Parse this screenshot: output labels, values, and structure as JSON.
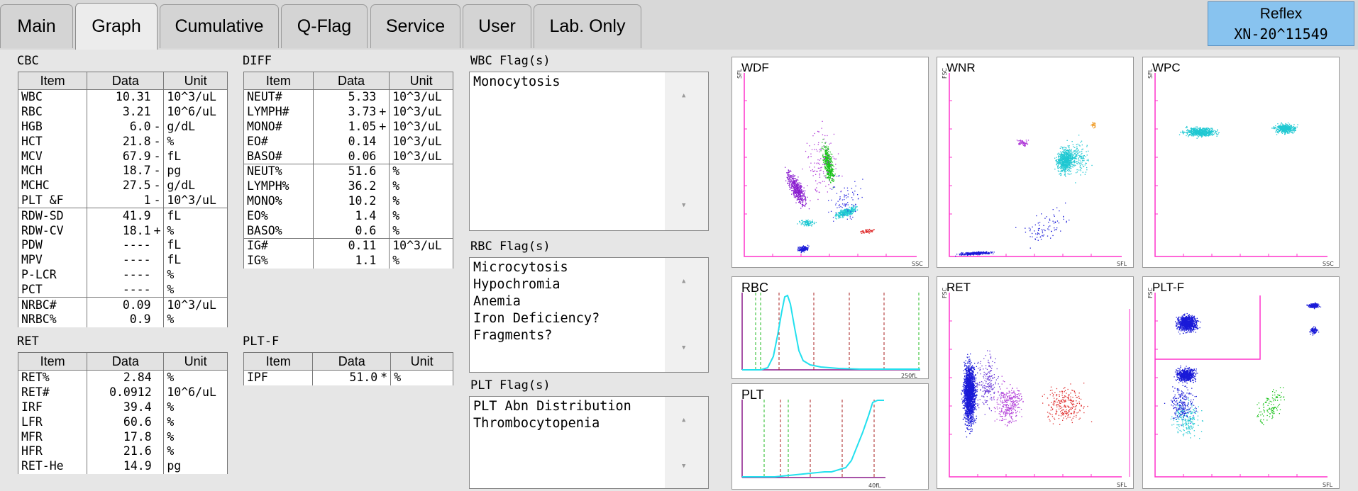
{
  "tabs": [
    "Main",
    "Graph",
    "Cumulative",
    "Q-Flag",
    "Service",
    "User",
    "Lab. Only"
  ],
  "active_tab": "Graph",
  "reflex": {
    "label": "Reflex",
    "sample_id": "XN-20^11549"
  },
  "cbc": {
    "title": "CBC",
    "headers": [
      "Item",
      "Data",
      "Unit"
    ],
    "rows": [
      {
        "item": "WBC",
        "data": "10.31",
        "flag": "",
        "unit": "10^3/uL"
      },
      {
        "item": "RBC",
        "data": "3.21",
        "flag": "",
        "unit": "10^6/uL"
      },
      {
        "item": "HGB",
        "data": "6.0",
        "flag": "-",
        "unit": "g/dL"
      },
      {
        "item": "HCT",
        "data": "21.8",
        "flag": "-",
        "unit": "%"
      },
      {
        "item": "MCV",
        "data": "67.9",
        "flag": "-",
        "unit": "fL"
      },
      {
        "item": "MCH",
        "data": "18.7",
        "flag": "-",
        "unit": "pg"
      },
      {
        "item": "MCHC",
        "data": "27.5",
        "flag": "-",
        "unit": "g/dL"
      },
      {
        "item": "PLT &F",
        "data": "1",
        "flag": "-",
        "unit": "10^3/uL"
      },
      {
        "item": "RDW-SD",
        "data": "41.9",
        "flag": "",
        "unit": "fL"
      },
      {
        "item": "RDW-CV",
        "data": "18.1",
        "flag": "+",
        "unit": "%"
      },
      {
        "item": "PDW",
        "data": "----",
        "flag": "",
        "unit": "fL"
      },
      {
        "item": "MPV",
        "data": "----",
        "flag": "",
        "unit": "fL"
      },
      {
        "item": "P-LCR",
        "data": "----",
        "flag": "",
        "unit": "%"
      },
      {
        "item": "PCT",
        "data": "----",
        "flag": "",
        "unit": "%"
      },
      {
        "item": "NRBC#",
        "data": "0.09",
        "flag": "",
        "unit": "10^3/uL"
      },
      {
        "item": "NRBC%",
        "data": "0.9",
        "flag": "",
        "unit": "%"
      }
    ]
  },
  "diff": {
    "title": "DIFF",
    "headers": [
      "Item",
      "Data",
      "Unit"
    ],
    "rows": [
      {
        "item": "NEUT#",
        "data": "5.33",
        "flag": "",
        "unit": "10^3/uL"
      },
      {
        "item": "LYMPH#",
        "data": "3.73",
        "flag": "+",
        "unit": "10^3/uL"
      },
      {
        "item": "MONO#",
        "data": "1.05",
        "flag": "+",
        "unit": "10^3/uL"
      },
      {
        "item": "EO#",
        "data": "0.14",
        "flag": "",
        "unit": "10^3/uL"
      },
      {
        "item": "BASO#",
        "data": "0.06",
        "flag": "",
        "unit": "10^3/uL"
      },
      {
        "item": "NEUT%",
        "data": "51.6",
        "flag": "",
        "unit": "%"
      },
      {
        "item": "LYMPH%",
        "data": "36.2",
        "flag": "",
        "unit": "%"
      },
      {
        "item": "MONO%",
        "data": "10.2",
        "flag": "",
        "unit": "%"
      },
      {
        "item": "EO%",
        "data": "1.4",
        "flag": "",
        "unit": "%"
      },
      {
        "item": "BASO%",
        "data": "0.6",
        "flag": "",
        "unit": "%"
      },
      {
        "item": "IG#",
        "data": "0.11",
        "flag": "",
        "unit": "10^3/uL"
      },
      {
        "item": "IG%",
        "data": "1.1",
        "flag": "",
        "unit": "%"
      }
    ]
  },
  "ret": {
    "title": "RET",
    "headers": [
      "Item",
      "Data",
      "Unit"
    ],
    "rows": [
      {
        "item": "RET%",
        "data": "2.84",
        "flag": "",
        "unit": "%"
      },
      {
        "item": "RET#",
        "data": "0.0912",
        "flag": "",
        "unit": "10^6/uL"
      },
      {
        "item": "IRF",
        "data": "39.4",
        "flag": "",
        "unit": "%"
      },
      {
        "item": "LFR",
        "data": "60.6",
        "flag": "",
        "unit": "%"
      },
      {
        "item": "MFR",
        "data": "17.8",
        "flag": "",
        "unit": "%"
      },
      {
        "item": "HFR",
        "data": "21.6",
        "flag": "",
        "unit": "%"
      },
      {
        "item": "RET-He",
        "data": "14.9",
        "flag": "",
        "unit": "pg"
      }
    ]
  },
  "pltf": {
    "title": "PLT-F",
    "headers": [
      "Item",
      "Data",
      "Unit"
    ],
    "rows": [
      {
        "item": "IPF",
        "data": "51.0",
        "flag": "*",
        "unit": "%"
      }
    ]
  },
  "flags": {
    "wbc": {
      "title": "WBC Flag(s)",
      "lines": [
        "Monocytosis"
      ]
    },
    "rbc": {
      "title": "RBC Flag(s)",
      "lines": [
        "Microcytosis",
        "Hypochromia",
        "Anemia",
        "Iron Deficiency?",
        "Fragments?"
      ]
    },
    "plt": {
      "title": "PLT Flag(s)",
      "lines": [
        "PLT Abn Distribution",
        "Thrombocytopenia"
      ]
    }
  },
  "graphs": {
    "wdf": {
      "title": "WDF",
      "y_axis": "SFL",
      "x_axis": "SSC"
    },
    "wnr": {
      "title": "WNR",
      "y_axis": "FSC",
      "x_axis": "SFL"
    },
    "wpc": {
      "title": "WPC",
      "y_axis": "SFL",
      "x_axis": "SSC"
    },
    "rbc": {
      "title": "RBC",
      "x_max": "250fL"
    },
    "plt": {
      "title": "PLT",
      "x_max": "40fL"
    },
    "ret": {
      "title": "RET",
      "y_axis": "FSC",
      "x_axis": "SFL"
    },
    "plt_f": {
      "title": "PLT-F",
      "y_axis": "FSC",
      "x_axis": "SFL"
    }
  },
  "colors": {
    "axis": "#ff33cc",
    "histogram": "#22e0ee",
    "reflex_bg": "#88c3ef"
  }
}
